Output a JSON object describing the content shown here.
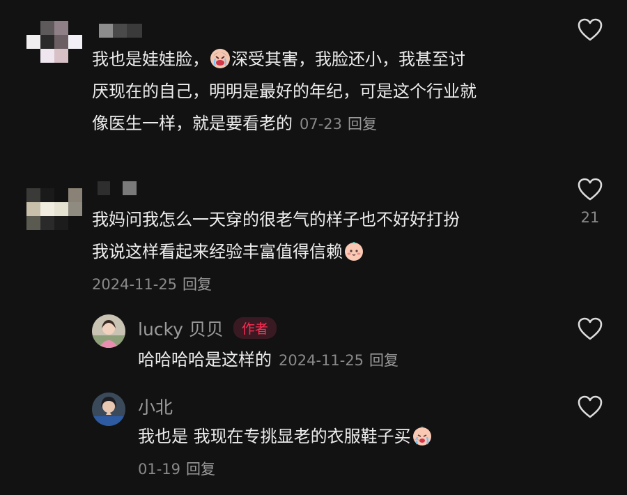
{
  "comments": [
    {
      "text_line1": "我也是娃娃脸，",
      "text_line1_b": "深受其害，我脸还小，我甚至讨",
      "text_line2": "厌现在的自己，明明是最好的年纪，可是这个行业就",
      "text_line3": "像医生一样，就是要看老的",
      "date": "07-23",
      "reply_label": "回复",
      "emoji": "crying-face-emoji"
    },
    {
      "text_line1": "我妈问我怎么一天穿的很老气的样子也不好好打扮",
      "text_line2": "我说这样看起来经验丰富值得信赖",
      "date": "2024-11-25",
      "reply_label": "回复",
      "like_count": "21",
      "emoji": "baby-face-emoji"
    }
  ],
  "replies": [
    {
      "username": "lucky 贝贝",
      "badge": "作者",
      "text": "哈哈哈哈是这样的",
      "date": "2024-11-25",
      "reply_label": "回复"
    },
    {
      "username": "小北",
      "text": "我也是 我现在专挑显老的衣服鞋子买",
      "date": "01-19",
      "reply_label": "回复",
      "emoji": "crying-baby-emoji"
    }
  ],
  "colors": {
    "background": "#121212",
    "badge": "#fe2c55",
    "meta": "#8a8a8a"
  }
}
